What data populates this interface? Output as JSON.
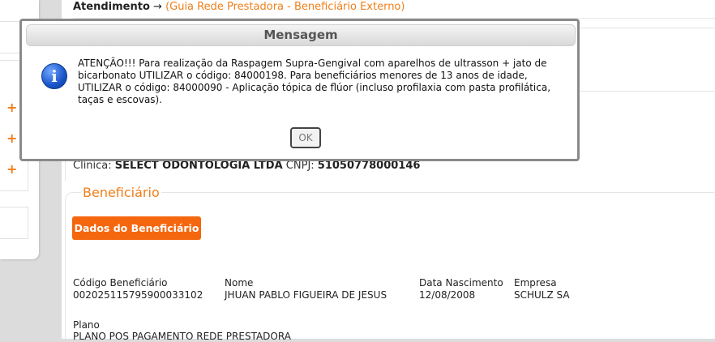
{
  "breadcrumb": {
    "main": "Atendimento",
    "arrow": "→",
    "link": "(Guia Rede Prestadora - Beneficiário Externo)"
  },
  "sidebar": {
    "plus_icons": [
      "+",
      "+",
      "+"
    ]
  },
  "clinic": {
    "label": "Clínica:",
    "name": "SELECT ODONTOLOGIA LTDA",
    "cnpj_label": "CNPJ:",
    "cnpj": "51050778000146"
  },
  "beneficiario": {
    "section_title": "Beneficiário",
    "button_label": "Dados do Beneficiário",
    "fields": {
      "codigo_label": "Código Beneficiário",
      "codigo_value": "002025115795900033102",
      "nome_label": "Nome",
      "nome_value": "JHUAN PABLO FIGUEIRA DE JESUS",
      "nascimento_label": "Data Nascimento",
      "nascimento_value": "12/08/2008",
      "empresa_label": "Empresa",
      "empresa_value": "SCHULZ SA",
      "plano_label": "Plano",
      "plano_value": "PLANO POS PAGAMENTO REDE PRESTADORA"
    }
  },
  "modal": {
    "title": "Mensagem",
    "icon": "info-icon",
    "message": "ATENÇÃO!!! Para realização da Raspagem Supra-Gengival com aparelhos de ultrasson + jato de bicarbonato UTILIZAR o código: 84000198. Para beneficiários menores de 13 anos de idade, UTILIZAR o código: 84000090 - Aplicação tópica de flúor (incluso profilaxia com pasta profilática, taças e escovas).",
    "ok_label": "OK"
  },
  "colors": {
    "accent": "#f07f1a",
    "button": "#f5670f"
  }
}
